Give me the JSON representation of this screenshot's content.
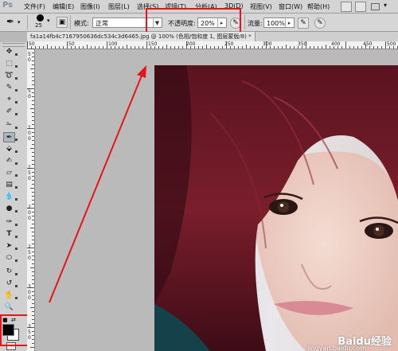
{
  "app": {
    "logo": "Ps"
  },
  "menu": [
    {
      "id": "file",
      "label": "文件(F)"
    },
    {
      "id": "edit",
      "label": "编辑(E)"
    },
    {
      "id": "image",
      "label": "图像(I)"
    },
    {
      "id": "layer",
      "label": "图层(L)"
    },
    {
      "id": "select",
      "label": "选择(S)"
    },
    {
      "id": "filter",
      "label": "滤镜(T)"
    },
    {
      "id": "analysis",
      "label": "分析(A)"
    },
    {
      "id": "3d",
      "label": "3D(D)"
    },
    {
      "id": "view",
      "label": "视图(V)"
    },
    {
      "id": "window",
      "label": "窗口(W)"
    },
    {
      "id": "help",
      "label": "帮助(H)"
    }
  ],
  "options": {
    "brush_size": "25",
    "mode_label": "模式:",
    "mode_value": "正常",
    "opacity_label": "不透明度:",
    "opacity_value": "20%",
    "flow_label": "流量:",
    "flow_value": "100%"
  },
  "document_tab": {
    "title": "fa1a14fb4c7167950636dc534c3d6465.jpg @ 100% (色相/饱和度 1, 图层蒙版/8) *"
  },
  "ruler": {
    "h_ticks": [
      "50",
      "50",
      "100",
      "150",
      "200",
      "250",
      "300",
      "350",
      "400",
      "450",
      "500"
    ],
    "v_ticks": [
      "5",
      "0",
      "5",
      "0",
      "1",
      "0",
      "0",
      "1",
      "5",
      "0",
      "2",
      "0",
      "0",
      "2",
      "5",
      "0",
      "3",
      "0",
      "0",
      "3",
      "5",
      "0"
    ]
  },
  "annotations": {
    "color": "#e8141c"
  },
  "watermark": {
    "brand": "Baidu经验",
    "url": "jingyan.baidu.com"
  },
  "colors": {
    "foreground": "#000000",
    "background": "#ffffff"
  }
}
